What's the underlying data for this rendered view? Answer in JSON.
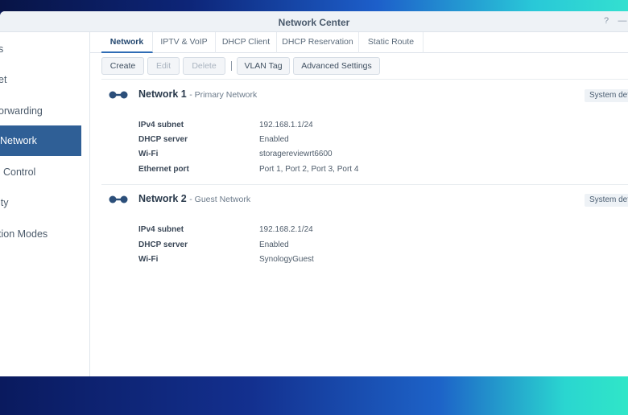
{
  "window": {
    "title": "Network Center",
    "help_glyph": "?",
    "minimize_glyph": "—"
  },
  "sidebar": {
    "items": [
      {
        "label": "s",
        "active": false
      },
      {
        "label": "et",
        "active": false
      },
      {
        "label": "orwarding",
        "active": false
      },
      {
        "label": "Network",
        "active": true
      },
      {
        "label": "Control",
        "active": false
      },
      {
        "label": "ity",
        "active": false
      },
      {
        "label": "tion Modes",
        "active": false
      }
    ]
  },
  "tabs": [
    {
      "label": "Network",
      "active": true
    },
    {
      "label": "IPTV & VoIP",
      "active": false
    },
    {
      "label": "DHCP Client",
      "active": false
    },
    {
      "label": "DHCP Reservation",
      "active": false
    },
    {
      "label": "Static Route",
      "active": false
    }
  ],
  "toolbar": {
    "create": "Create",
    "edit": "Edit",
    "delete": "Delete",
    "separator": "|",
    "vlan_tag": "VLAN Tag",
    "advanced_settings": "Advanced Settings"
  },
  "networks": [
    {
      "name": "Network 1",
      "subtitle": "- Primary Network",
      "system_button": "System def",
      "rows": [
        {
          "label": "IPv4 subnet",
          "value": "192.168.1.1/24"
        },
        {
          "label": "DHCP server",
          "value": "Enabled"
        },
        {
          "label": "Wi-Fi",
          "value": "storagereviewrt6600"
        },
        {
          "label": "Ethernet port",
          "value": "Port 1, Port 2, Port 3, Port 4"
        }
      ]
    },
    {
      "name": "Network 2",
      "subtitle": "- Guest Network",
      "system_button": "System def",
      "rows": [
        {
          "label": "IPv4 subnet",
          "value": "192.168.2.1/24"
        },
        {
          "label": "DHCP server",
          "value": "Enabled"
        },
        {
          "label": "Wi-Fi",
          "value": "SynologyGuest"
        }
      ]
    }
  ],
  "colors": {
    "accent": "#2f5f96",
    "icon": "#2c4f7a"
  }
}
